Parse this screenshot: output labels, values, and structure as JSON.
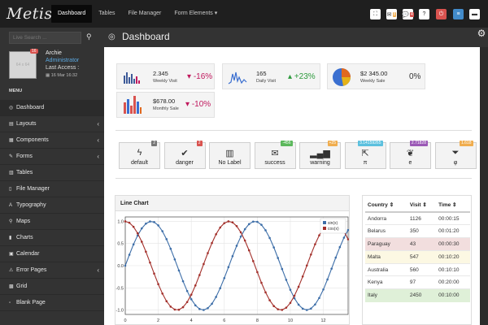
{
  "app": {
    "logo": "Metis"
  },
  "nav": [
    "Dashboard",
    "Tables",
    "File Manager",
    "Form Elements ▾"
  ],
  "topbar": {
    "buttons": [
      {
        "icon": "expand-icon",
        "glyph": "⛶",
        "bg": "#ffffff",
        "badge": ""
      },
      {
        "icon": "envelope-icon",
        "glyph": "✉",
        "bg": "#ffffff",
        "badge": "8"
      },
      {
        "icon": "comments-icon",
        "glyph": "💬",
        "bg": "#ffffff",
        "badge": "4"
      },
      {
        "icon": "question-icon",
        "glyph": "?",
        "bg": "#ffffff",
        "badge": ""
      },
      {
        "icon": "power-icon",
        "glyph": "⏻",
        "bg": "#d9534f",
        "badge": ""
      },
      {
        "icon": "list-icon",
        "glyph": "≡",
        "bg": "#428bca",
        "badge": ""
      },
      {
        "icon": "comment-icon",
        "glyph": "▬",
        "bg": "#ffffff",
        "badge": ""
      }
    ]
  },
  "sidebar": {
    "search_placeholder": "Live Search ...",
    "user": {
      "name": "Archie",
      "role": "Administrator",
      "access": "Last Access :",
      "date": "16 Mar 16:32",
      "badge": "16",
      "avatar_text": "64 x 64"
    },
    "menu_title": "MENU",
    "items": [
      {
        "label": "Dashboard",
        "icon": "dashboard-icon",
        "glyph": "◎",
        "chevron": false
      },
      {
        "label": "Layouts",
        "icon": "layouts-icon",
        "glyph": "▤",
        "chevron": true
      },
      {
        "label": "Components",
        "icon": "components-icon",
        "glyph": "▦",
        "chevron": true
      },
      {
        "label": "Forms",
        "icon": "pencil-icon",
        "glyph": "✎",
        "chevron": true
      },
      {
        "label": "Tables",
        "icon": "table-icon",
        "glyph": "▥",
        "chevron": false
      },
      {
        "label": "File Manager",
        "icon": "file-icon",
        "glyph": "▯",
        "chevron": false
      },
      {
        "label": "Typography",
        "icon": "font-icon",
        "glyph": "A",
        "chevron": false
      },
      {
        "label": "Maps",
        "icon": "map-marker-icon",
        "glyph": "⚲",
        "chevron": false
      },
      {
        "label": "Charts",
        "icon": "chart-icon",
        "glyph": "▮",
        "chevron": false
      },
      {
        "label": "Calendar",
        "icon": "calendar-icon",
        "glyph": "▣",
        "chevron": false
      },
      {
        "label": "Error Pages",
        "icon": "warning-icon",
        "glyph": "⚠",
        "chevron": true
      },
      {
        "label": "Grid",
        "icon": "grid-icon",
        "glyph": "▩",
        "chevron": false
      },
      {
        "label": "Blank Page",
        "icon": "blank-file-icon",
        "glyph": "▫",
        "chevron": false
      }
    ]
  },
  "page": {
    "title": "Dashboard"
  },
  "stats": [
    {
      "value": "2.345",
      "label": "Weekly Visit",
      "change": "-16%",
      "direction": "down",
      "spark": "bar"
    },
    {
      "value": "165",
      "label": "Daily Visit",
      "change": "+23%",
      "direction": "up",
      "spark": "line"
    },
    {
      "value": "$2 345.00",
      "label": "Weekly Sale",
      "change": "0%",
      "direction": "none",
      "spark": "pie"
    },
    {
      "value": "$678.00",
      "label": "Monthly Sale",
      "change": "-10%",
      "direction": "down",
      "spark": "bar2"
    }
  ],
  "quick_buttons": [
    {
      "label": "default",
      "icon": "bolt-icon",
      "glyph": "ϟ",
      "badge": "2",
      "badge_color": "#777777"
    },
    {
      "label": "danger",
      "icon": "check-icon",
      "glyph": "✔",
      "badge": "2",
      "badge_color": "#d9534f"
    },
    {
      "label": "No Label",
      "icon": "building-icon",
      "glyph": "▥",
      "badge": "",
      "badge_color": ""
    },
    {
      "label": "success",
      "icon": "envelope-icon",
      "glyph": "✉",
      "badge": "-456",
      "badge_color": "#5cb85c"
    },
    {
      "label": "warning",
      "icon": "signal-icon",
      "glyph": "▂▄▆",
      "badge": "+25",
      "badge_color": "#f0ad4e"
    },
    {
      "label": "π",
      "icon": "external-link-icon",
      "glyph": "⇱",
      "badge": "3.14159265",
      "badge_color": "#5bc0de"
    },
    {
      "label": "e",
      "icon": "leaf-icon",
      "glyph": "❦",
      "badge": "2.71828",
      "badge_color": "#9b59b6"
    },
    {
      "label": "φ",
      "icon": "filter-icon",
      "glyph": "⏷",
      "badge": "1.618",
      "badge_color": "#f0ad4e"
    }
  ],
  "chart_panel": {
    "title": "Line Chart"
  },
  "chart_data": {
    "type": "line",
    "xlim": [
      0,
      13.5
    ],
    "ylim": [
      -1.1,
      1.1
    ],
    "x_ticks": [
      0,
      2,
      4,
      6,
      8,
      10,
      12
    ],
    "y_ticks": [
      1.0,
      0.5,
      0.0,
      -0.5,
      -1.0
    ],
    "y_tick_labels": [
      "1.0",
      "0.5",
      "0.0",
      "-0.5",
      "-1.0"
    ],
    "legend": "top-right",
    "grid": true,
    "sample_step": 0.25,
    "series": [
      {
        "name": "sin(x)",
        "fn": "sin",
        "color": "#3d6ea8"
      },
      {
        "name": "cos(x)",
        "fn": "cos",
        "color": "#a3302b"
      }
    ]
  },
  "visits_table": {
    "headers": [
      "Country ⇕",
      "Visit ⇕",
      "Time ⇕"
    ],
    "rows": [
      {
        "country": "Andorra",
        "visit": "1126",
        "time": "00:00:15",
        "bg": "#ffffff"
      },
      {
        "country": "Belarus",
        "visit": "350",
        "time": "00:01:20",
        "bg": "#ffffff"
      },
      {
        "country": "Paraguay",
        "visit": "43",
        "time": "00:00:30",
        "bg": "#f2dede"
      },
      {
        "country": "Malta",
        "visit": "547",
        "time": "00:10:20",
        "bg": "#fcf8e3"
      },
      {
        "country": "Australia",
        "visit": "560",
        "time": "00:10:10",
        "bg": "#ffffff"
      },
      {
        "country": "Kenya",
        "visit": "97",
        "time": "00:20:00",
        "bg": "#ffffff"
      },
      {
        "country": "Italy",
        "visit": "2450",
        "time": "00:10:00",
        "bg": "#dff0d8"
      }
    ]
  }
}
